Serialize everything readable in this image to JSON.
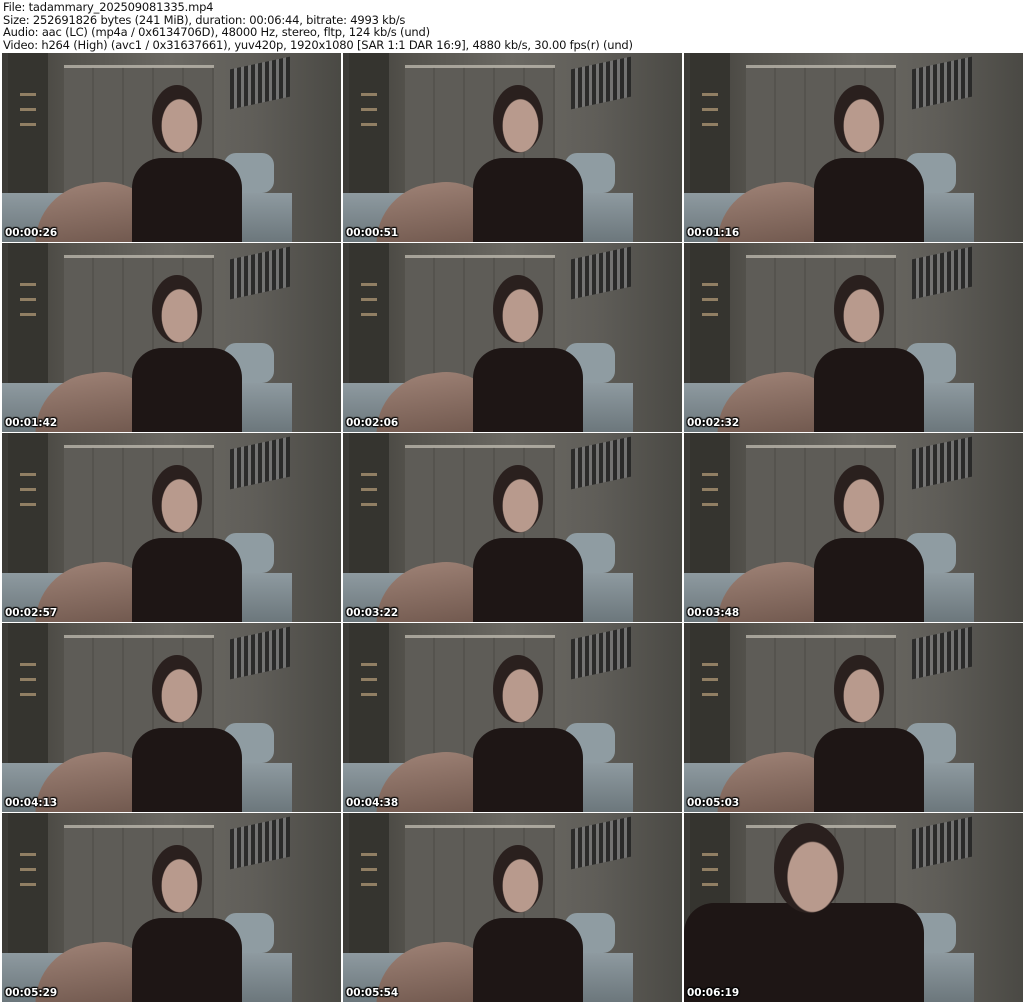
{
  "header": {
    "file": "File: tadammary_202509081335.mp4",
    "size": "Size: 252691826 bytes (241 MiB), duration: 00:06:44, bitrate: 4993 kb/s",
    "audio": "Audio: aac (LC) (mp4a / 0x6134706D), 48000 Hz, stereo, fltp, 124 kb/s (und)",
    "video": "Video: h264 (High) (avc1 / 0x31637661), yuv420p, 1920x1080 [SAR 1:1 DAR 16:9], 4880 kb/s, 30.00 fps(r) (und)"
  },
  "thumbnails": [
    {
      "timestamp": "00:00:26"
    },
    {
      "timestamp": "00:00:51"
    },
    {
      "timestamp": "00:01:16"
    },
    {
      "timestamp": "00:01:42"
    },
    {
      "timestamp": "00:02:06"
    },
    {
      "timestamp": "00:02:32"
    },
    {
      "timestamp": "00:02:57"
    },
    {
      "timestamp": "00:03:22"
    },
    {
      "timestamp": "00:03:48"
    },
    {
      "timestamp": "00:04:13"
    },
    {
      "timestamp": "00:04:38"
    },
    {
      "timestamp": "00:05:03"
    },
    {
      "timestamp": "00:05:29"
    },
    {
      "timestamp": "00:05:54"
    },
    {
      "timestamp": "00:06:19"
    }
  ]
}
